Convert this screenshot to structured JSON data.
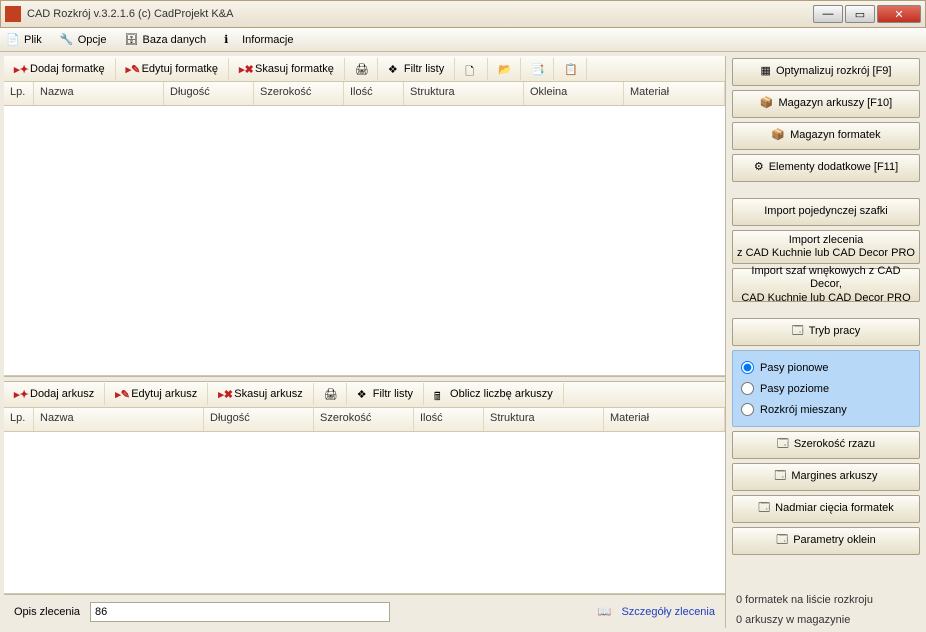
{
  "window": {
    "title": "CAD Rozkrój v.3.2.1.6  (c) CadProjekt K&A"
  },
  "menu": {
    "file": "Plik",
    "options": "Opcje",
    "database": "Baza danych",
    "info": "Informacje"
  },
  "toolbar1": {
    "add": "Dodaj formatkę",
    "edit": "Edytuj formatkę",
    "delete": "Skasuj formatkę",
    "filter": "Filtr listy"
  },
  "table1": {
    "lp": "Lp.",
    "name": "Nazwa",
    "length": "Długość",
    "width": "Szerokość",
    "qty": "Ilość",
    "structure": "Struktura",
    "edging": "Okleina",
    "material": "Materiał"
  },
  "toolbar2": {
    "add": "Dodaj arkusz",
    "edit": "Edytuj arkusz",
    "delete": "Skasuj arkusz",
    "filter": "Filtr listy",
    "calc": "Oblicz liczbę arkuszy"
  },
  "table2": {
    "lp": "Lp.",
    "name": "Nazwa",
    "length": "Długość",
    "width": "Szerokość",
    "qty": "Ilość",
    "structure": "Struktura",
    "material": "Materiał"
  },
  "bottom": {
    "order_label": "Opis zlecenia",
    "order_value": "86",
    "details": "Szczegóły zlecenia"
  },
  "side": {
    "optimize": "Optymalizuj rozkrój [F9]",
    "sheets": "Magazyn arkuszy [F10]",
    "panels": "Magazyn formatek",
    "extras": "Elementy dodatkowe [F11]",
    "import1": "Import pojedynczej szafki",
    "import2a": "Import zlecenia",
    "import2b": "z CAD Kuchnie lub CAD Decor PRO",
    "import3a": "Import szaf wnękowych z CAD Decor,",
    "import3b": "CAD Kuchnie lub CAD Decor PRO",
    "mode": "Tryb pracy",
    "radio1": "Pasy pionowe",
    "radio2": "Pasy poziome",
    "radio3": "Rozkrój mieszany",
    "kerf": "Szerokość rzazu",
    "margin": "Margines arkuszy",
    "overcut": "Nadmiar cięcia formatek",
    "edgeparam": "Parametry oklein",
    "status1": "0 formatek na liście rozkroju",
    "status2": "0 arkuszy w magazynie"
  }
}
